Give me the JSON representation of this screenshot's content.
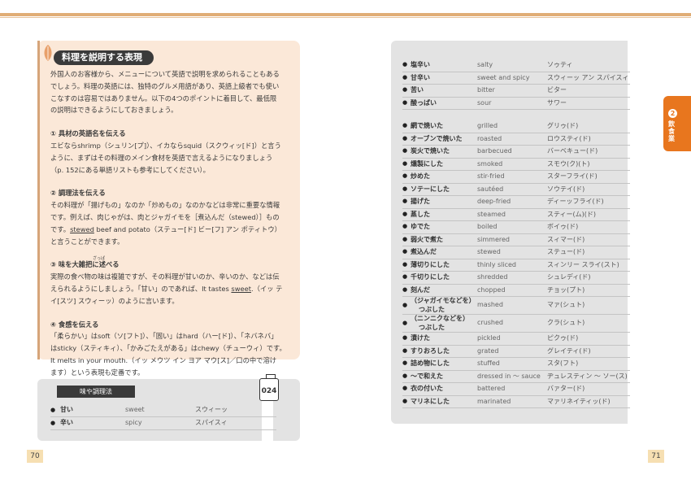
{
  "explain": {
    "title": "料理を説明する表現",
    "intro": [
      "外国人のお客様から、メニューについて英語で説明を求められることもある",
      "でしょう。料理の英語には、独特のグルメ用語があり、英語上級者でも使い",
      "こなすのは容易ではありません。以下の4つのポイントに着目して、最低限",
      "の説明はできるようにしておきましょう。"
    ],
    "s1_head": "① 具材の英語名を伝える",
    "s1": [
      "エビならshrimp（シュリン[プ]）、イカならsquid（スクウィッ[ド]）と言う",
      "ように、まずはその料理のメイン食材を英語で言えるようになりましょう",
      "（p. 152にある単語リストも参考にしてください）。"
    ],
    "s2_head": "② 調理法を伝える",
    "s2": [
      "その料理が「揚げもの」なのか「炒めもの」なのかなどは非常に重要な情報",
      "です。例えば、肉じゃがは、肉とジャガイモを［煮込んだ（stewed）］もの"
    ],
    "s2c_pre": "です。",
    "s2c_ul": "stewed",
    "s2c_post": " beef and potato（ステュー[ド] ビー[フ] アン ポティトウ）",
    "s2d": "と言うことができます。",
    "s3_head": "③ 味を大雑把に述べる",
    "s3_ruby": "ざっぱ",
    "s3": [
      "実際の食べ物の味は複雑ですが、その料理が甘いのか、辛いのか、などは伝"
    ],
    "s3b_pre": "えられるようにしましょう。「甘い」のであれば、It tastes ",
    "s3b_ul": "sweet",
    "s3b_post": ".（イッ テ",
    "s3c": "イ[スツ] スウィーッ）のように言います。",
    "s4_head": "④ 食感を伝える",
    "s4": [
      "「柔らかい」はsoft（ソ[フト]）、「固い」はhard（ハー[ド]）、「ネバネバ」",
      "はsticky（スティキィ）、「かみごたえがある」はchewy（チューウィ）です。",
      "It melts in your mouth.（イッ メウツ イン ヨア マウ[ス]／口の中で溶け",
      "ます）という表現も定番です。"
    ]
  },
  "left_table": {
    "title": "味や調理法",
    "audio": "024",
    "rows": [
      {
        "jp": "甘い",
        "en": "sweet",
        "ka": "スウィーッ"
      },
      {
        "jp": "辛い",
        "en": "spicy",
        "ka": "スパイスィ"
      }
    ]
  },
  "right_table": {
    "groups": [
      [
        {
          "jp": "塩辛い",
          "en": "salty",
          "ka": "ソゥティ"
        },
        {
          "jp": "甘辛い",
          "en": "sweet and spicy",
          "ka": "スウィーッ アン スパイスィ"
        },
        {
          "jp": "苦い",
          "en": "bitter",
          "ka": "ビター"
        },
        {
          "jp": "酸っぱい",
          "en": "sour",
          "ka": "サワー"
        }
      ],
      [
        {
          "jp": "網で焼いた",
          "en": "grilled",
          "ka": "グリゥ(ド)"
        },
        {
          "jp": "オーブンで焼いた",
          "en": "roasted",
          "ka": "ロウスティ(ド)"
        },
        {
          "jp": "炭火で焼いた",
          "en": "barbecued",
          "ka": "バーベキュー(ド)"
        },
        {
          "jp": "燻製にした",
          "en": "smoked",
          "ka": "スモウ(ク)(ト)"
        },
        {
          "jp": "炒めた",
          "en": "stir-fried",
          "ka": "スターフライ(ド)"
        },
        {
          "jp": "ソテーにした",
          "en": "sautéed",
          "ka": "ソウテイ(ド)"
        },
        {
          "jp": "揚げた",
          "en": "deep-fried",
          "ka": "ディーッフライ(ド)"
        },
        {
          "jp": "蒸した",
          "en": "steamed",
          "ka": "スティー(ム)(ド)"
        },
        {
          "jp": "ゆでた",
          "en": "boiled",
          "ka": "ボイゥ(ド)"
        },
        {
          "jp": "弱火で煮た",
          "en": "simmered",
          "ka": "スィマー(ド)"
        },
        {
          "jp": "煮込んだ",
          "en": "stewed",
          "ka": "ステュー(ド)"
        },
        {
          "jp": "薄切りにした",
          "en": "thinly sliced",
          "ka": "スィンリー スライ(スト)"
        },
        {
          "jp": "千切りにした",
          "en": "shredded",
          "ka": "シュレディ(ド)"
        },
        {
          "jp": "刻んだ",
          "en": "chopped",
          "ka": "チョッ(プト)"
        },
        {
          "jp": "（ジャガイモなどを）",
          "jp2": "つぶした",
          "en": "mashed",
          "ka": "マァ(シュト)"
        },
        {
          "jp": "（ニンニクなどを）",
          "jp2": "つぶした",
          "en": "crushed",
          "ka": "クラ(シュト)"
        },
        {
          "jp": "漬けた",
          "en": "pickled",
          "ka": "ピクゥ(ド)"
        },
        {
          "jp": "すりおろした",
          "en": "grated",
          "ka": "グレイティ(ド)"
        },
        {
          "jp": "詰め物にした",
          "en": "stuffed",
          "ka": "スタ(フト)"
        },
        {
          "jp": "～で和えた",
          "en": "dressed in ～ sauce",
          "ka": "ヂュレスティン ～ ソー(ス)"
        },
        {
          "jp": "衣の付いた",
          "en": "battered",
          "ka": "バァター(ド)"
        },
        {
          "jp": "マリネにした",
          "en": "marinated",
          "ka": "マァリネイティッ(ド)"
        }
      ]
    ]
  },
  "tab": {
    "num": "2",
    "label": "飲食業"
  },
  "pages": {
    "left": "70",
    "right": "71"
  },
  "colors": {
    "accent": "#e8761e",
    "box": "#fbe8d8",
    "table": "#e3e3e3"
  }
}
